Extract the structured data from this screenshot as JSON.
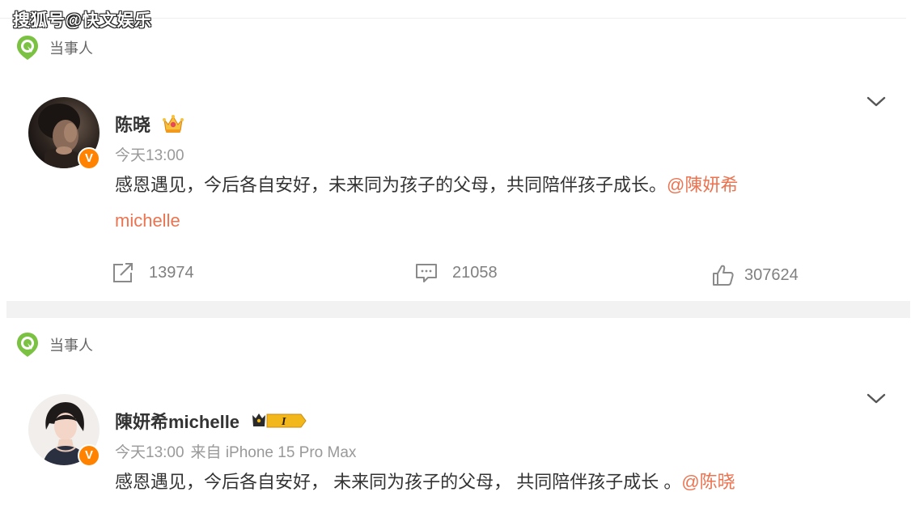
{
  "watermark": "搜狐号@快文娱乐",
  "posts": [
    {
      "tag": "当事人",
      "username": "陈晓",
      "time": "今天13:00",
      "source": "",
      "content_text": "感恩遇见，今后各自安好，未来同为孩子的父母，共同陪伴孩子成长。",
      "mention_line1": "@陳妍希",
      "mention_line2": "michelle",
      "verified_badge": "V",
      "actions": {
        "repost": "13974",
        "comment": "21058",
        "like": "307624"
      }
    },
    {
      "tag": "当事人",
      "username": "陳妍希michelle",
      "time": "今天13:00",
      "source": "来自 iPhone 15 Pro Max",
      "content_text": "感恩遇见，今后各自安好， 未来同为孩子的父母， 共同陪伴孩子成长 。",
      "mention": "@陈晓",
      "verified_badge": "V",
      "level_badge": "I"
    }
  ],
  "colors": {
    "accent": "#eb7350",
    "verified": "#ff8200",
    "tag_green": "#7bc142",
    "gold": "#f2b81b",
    "muted": "#999999"
  },
  "icons": {
    "tag": "location-leaf-icon",
    "crown": "crown-badge-icon",
    "vip": "vip-level-badge-icon",
    "more": "chevron-down-icon",
    "repost": "share-arrow-icon",
    "comment": "comment-icon",
    "like": "thumbs-up-icon"
  }
}
